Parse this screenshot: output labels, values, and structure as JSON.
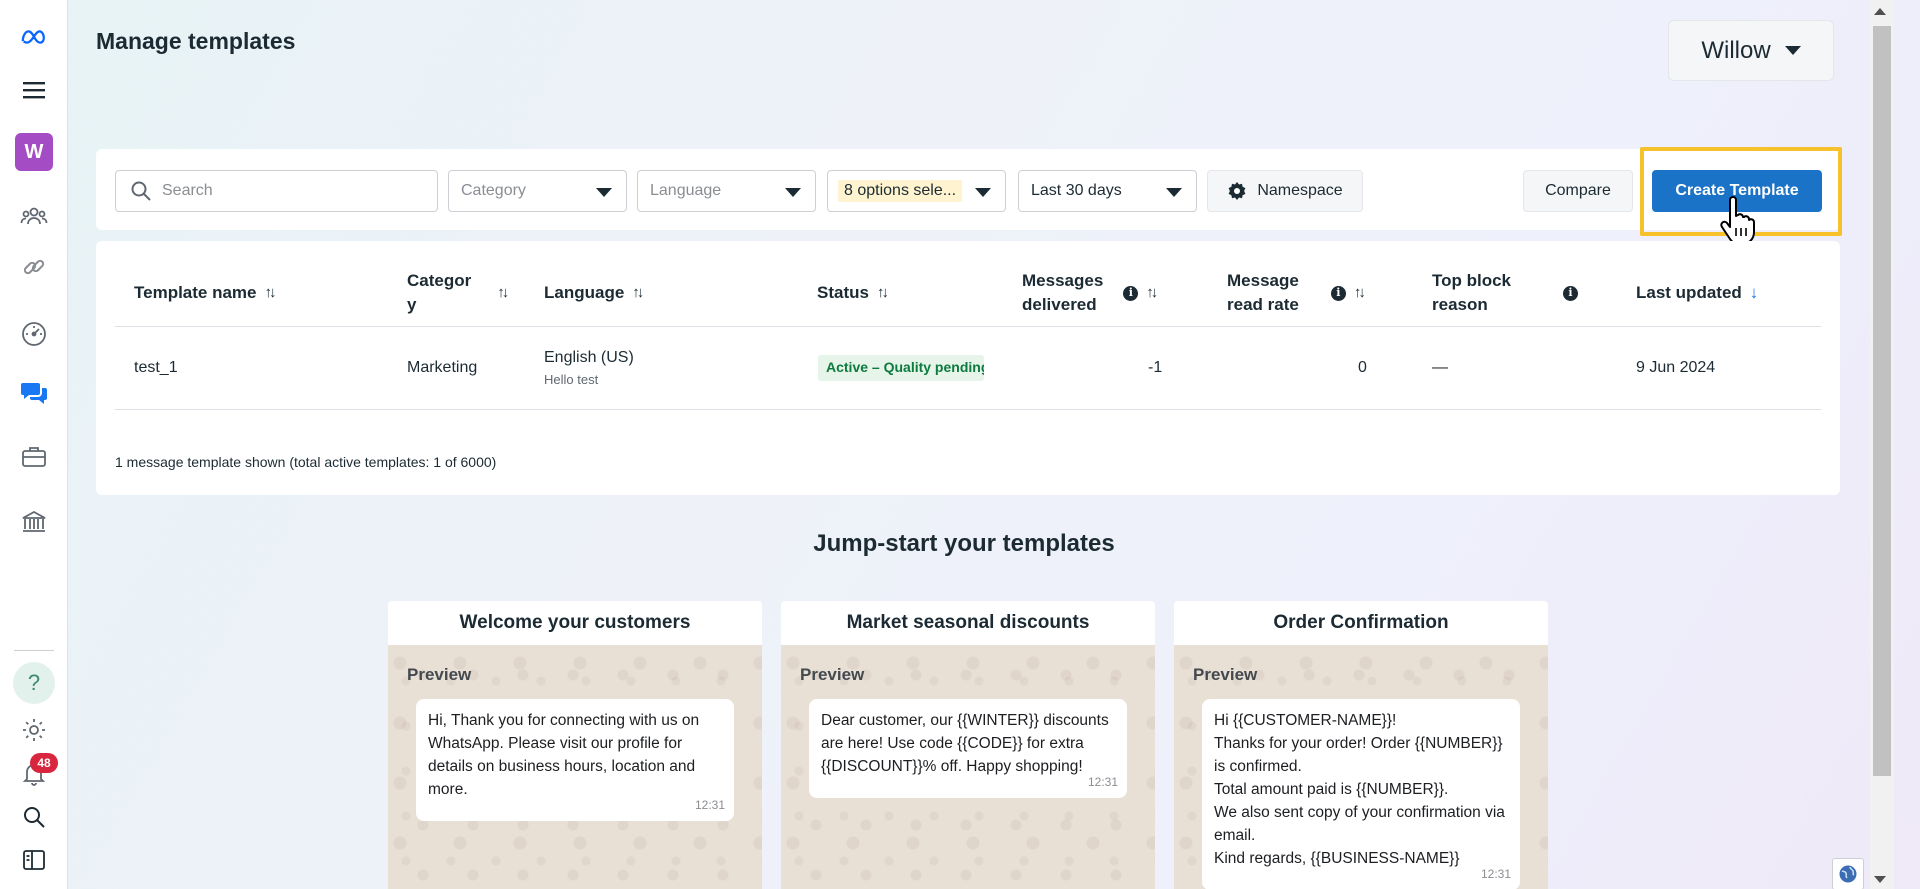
{
  "header": {
    "title": "Manage templates",
    "account_name": "Willow"
  },
  "sidebar": {
    "avatar_letter": "W",
    "notification_count": "48",
    "help_symbol": "?"
  },
  "filters": {
    "search_placeholder": "Search",
    "category": "Category",
    "language": "Language",
    "status_selection": "8 options sele...",
    "date_range": "Last 30 days",
    "namespace_label": "Namespace",
    "compare_label": "Compare",
    "create_label": "Create Template"
  },
  "table": {
    "columns": {
      "name": "Template name",
      "category_l1": "Categor",
      "category_l2": "y",
      "language": "Language",
      "status": "Status",
      "delivered_l1": "Messages",
      "delivered_l2": "delivered",
      "read_rate_l1": "Message",
      "read_rate_l2": "read rate",
      "block_l1": "Top block",
      "block_l2": "reason",
      "updated": "Last updated"
    },
    "rows": [
      {
        "name": "test_1",
        "category": "Marketing",
        "language": "English (US)",
        "language_sub": "Hello test",
        "status": "Active – Quality pending",
        "delivered": "-1",
        "read_rate": "0",
        "block_reason": "—",
        "updated": "9 Jun 2024"
      }
    ],
    "summary": "1 message template shown (total active templates: 1 of 6000)"
  },
  "jumpstart": {
    "title": "Jump-start your templates",
    "preview_label": "Preview",
    "cards": [
      {
        "title": "Welcome your customers",
        "message": "Hi, Thank you for connecting with us on WhatsApp. Please visit our profile for details on business hours, location and more.",
        "time": "12:31"
      },
      {
        "title": "Market seasonal discounts",
        "message": "Dear customer, our {{WINTER}} discounts are here! Use code {{CODE}} for extra {{DISCOUNT}}% off. Happy shopping!",
        "time": "12:31"
      },
      {
        "title": "Order Confirmation",
        "lines": [
          "Hi {{CUSTOMER-NAME}}!",
          "Thanks for your order! Order {{NUMBER}} is confirmed.",
          "Total amount paid is {{NUMBER}}.",
          "We also sent copy of your confirmation via email.",
          "Kind regards, {{BUSINESS-NAME}}"
        ],
        "time": "12:31"
      }
    ]
  },
  "colors": {
    "primary": "#1a73c6",
    "highlight_border": "#f7c12b",
    "status_green": "#0d7a3e",
    "avatar": "#a34cc4",
    "badge": "#d7263d"
  }
}
